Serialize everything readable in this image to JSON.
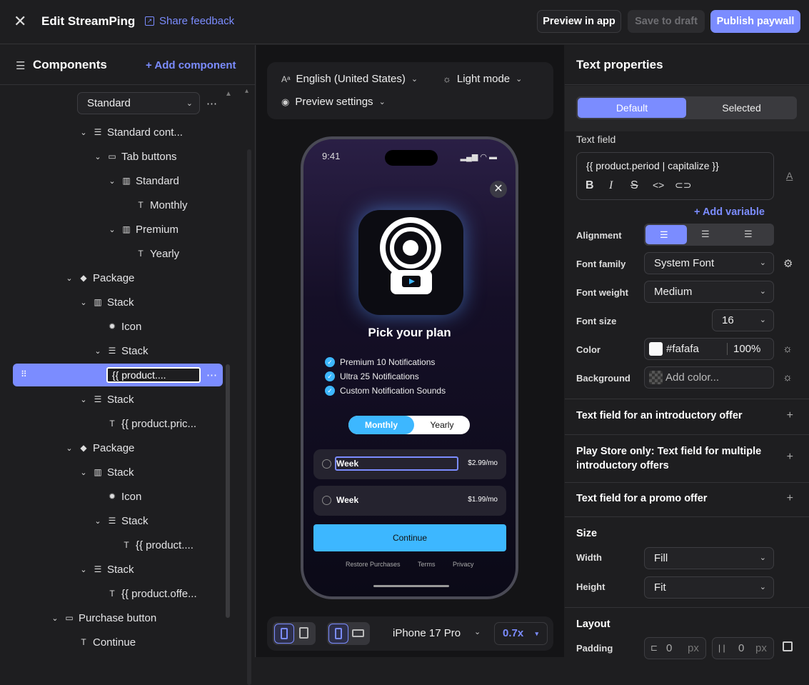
{
  "topbar": {
    "title": "Edit StreamPing",
    "share_feedback": "Share feedback",
    "preview_in_app": "Preview in app",
    "save_to_draft": "Save to draft",
    "publish_paywall": "Publish paywall"
  },
  "components": {
    "title": "Components",
    "add": "+ Add component",
    "dropdown_value": "Standard",
    "tree": [
      {
        "label": "Standard cont...",
        "icon": "stack-icon"
      },
      {
        "label": "Tab buttons",
        "icon": "toggle-icon"
      },
      {
        "label": "Standard",
        "icon": "columns-icon"
      },
      {
        "label": "Monthly",
        "icon": "text-icon"
      },
      {
        "label": "Premium",
        "icon": "columns-icon"
      },
      {
        "label": "Yearly",
        "icon": "text-icon"
      },
      {
        "label": "Package",
        "icon": "tag-icon"
      },
      {
        "label": "Stack",
        "icon": "columns-icon"
      },
      {
        "label": "Icon",
        "icon": "icon-icon"
      },
      {
        "label": "Stack",
        "icon": "stack-icon"
      },
      {
        "label": "{{ product....",
        "icon": "text-icon"
      },
      {
        "label": "Stack",
        "icon": "stack-icon"
      },
      {
        "label": "{{ product.pric...",
        "icon": "text-icon"
      },
      {
        "label": "Package",
        "icon": "tag-icon"
      },
      {
        "label": "Stack",
        "icon": "columns-icon"
      },
      {
        "label": "Icon",
        "icon": "icon-icon"
      },
      {
        "label": "Stack",
        "icon": "stack-icon"
      },
      {
        "label": "{{ product....",
        "icon": "text-icon"
      },
      {
        "label": "Stack",
        "icon": "stack-icon"
      },
      {
        "label": "{{ product.offe...",
        "icon": "text-icon"
      },
      {
        "label": "Purchase button",
        "icon": "button-icon"
      },
      {
        "label": "Continue",
        "icon": "text-icon"
      }
    ]
  },
  "preview": {
    "language": "English (United States)",
    "mode": "Light mode",
    "settings": "Preview settings",
    "device": "iPhone 17 Pro",
    "zoom": "0.7x"
  },
  "phone": {
    "time": "9:41",
    "title": "Pick your plan",
    "features": [
      "Premium 10 Notifications",
      "Ultra 25 Notifications",
      "Custom Notification Sounds"
    ],
    "tab_monthly": "Monthly",
    "tab_yearly": "Yearly",
    "packages": [
      {
        "name": "Week",
        "price": "$2.99/mo"
      },
      {
        "name": "Week",
        "price": "$1.99/mo"
      }
    ],
    "continue": "Continue",
    "links": [
      "Restore Purchases",
      "Terms",
      "Privacy"
    ]
  },
  "props": {
    "title": "Text properties",
    "state_default": "Default",
    "state_selected": "Selected",
    "text_field_label": "Text field",
    "text_field_value": "{{ product.period | capitalize }}",
    "add_variable": "+ Add variable",
    "alignment": "Alignment",
    "font_family_label": "Font family",
    "font_family": "System Font",
    "font_weight_label": "Font weight",
    "font_weight": "Medium",
    "font_size_label": "Font size",
    "font_size": "16",
    "color_label": "Color",
    "color_hex": "#fafafa",
    "color_opacity": "100%",
    "background_label": "Background",
    "background_placeholder": "Add color...",
    "intro_offer": "Text field for an introductory offer",
    "play_store_offers": "Play Store only: Text field for multiple introductory offers",
    "promo_offer": "Text field for a promo offer",
    "size_title": "Size",
    "width_label": "Width",
    "width": "Fill",
    "height_label": "Height",
    "height": "Fit",
    "layout_title": "Layout",
    "padding_label": "Padding",
    "padding_v": "0",
    "padding_h": "0",
    "unit": "px"
  },
  "colors": {
    "accent": "#7b8cff",
    "brand": "#3db7ff",
    "bg": "#1e1e20"
  }
}
